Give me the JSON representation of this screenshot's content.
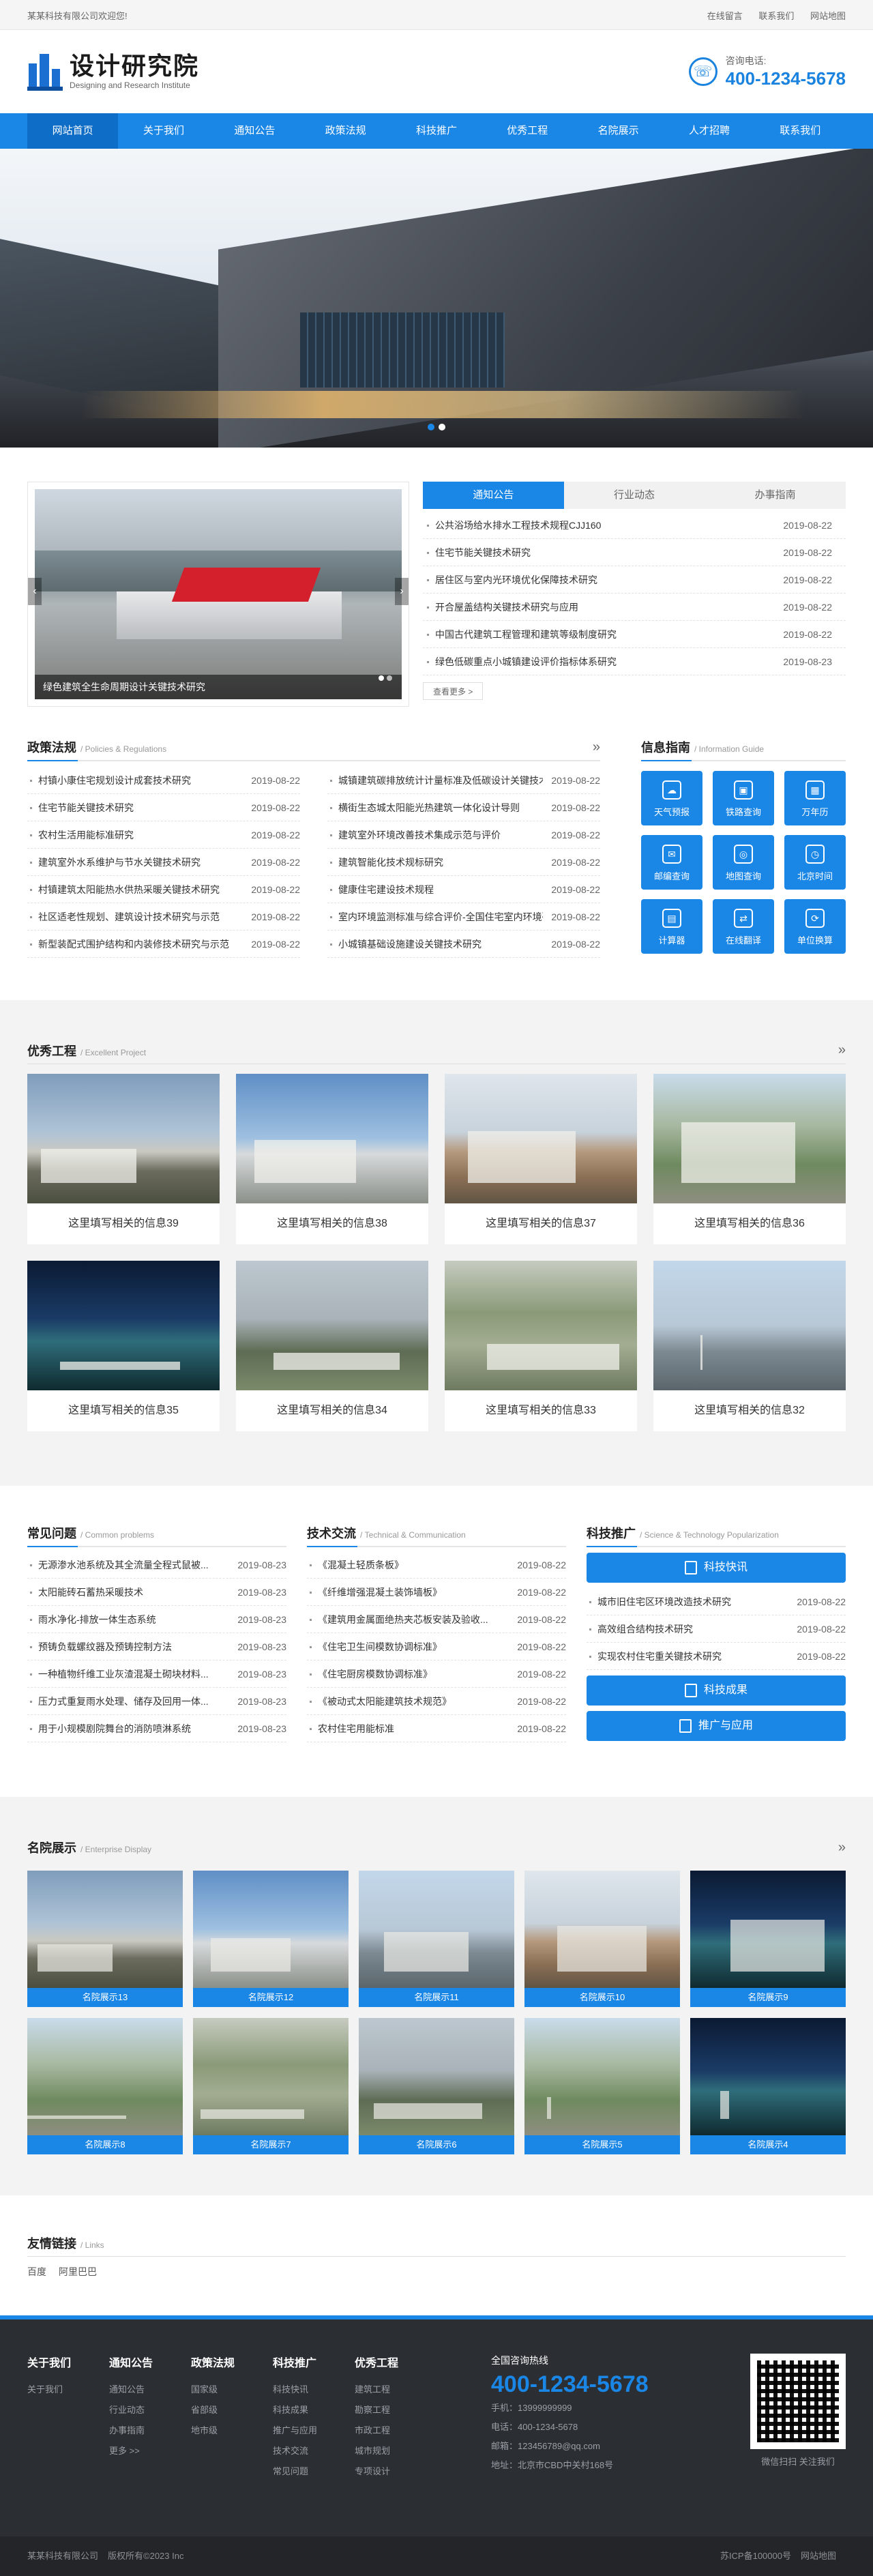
{
  "topbar": {
    "welcome": "某某科技有限公司欢迎您!",
    "links": [
      "在线留言",
      "联系我们",
      "网站地图"
    ]
  },
  "header": {
    "title": "设计研究院",
    "subtitle": "Designing and Research Institute",
    "phone_label": "咨询电话:",
    "phone": "400-1234-5678"
  },
  "nav": [
    "网站首页",
    "关于我们",
    "通知公告",
    "政策法规",
    "科技推广",
    "优秀工程",
    "名院展示",
    "人才招聘",
    "联系我们"
  ],
  "news": {
    "slide_caption": "绿色建筑全生命周期设计关键技术研究",
    "tabs": [
      "通知公告",
      "行业动态",
      "办事指南"
    ],
    "items": [
      {
        "t": "公共浴场给水排水工程技术规程CJJ160",
        "d": "2019-08-22"
      },
      {
        "t": "住宅节能关键技术研究",
        "d": "2019-08-22"
      },
      {
        "t": "居住区与室内光环境优化保障技术研究",
        "d": "2019-08-22"
      },
      {
        "t": "开合屋盖结构关键技术研究与应用",
        "d": "2019-08-22"
      },
      {
        "t": "中国古代建筑工程管理和建筑等级制度研究",
        "d": "2019-08-22"
      },
      {
        "t": "绿色低碳重点小城镇建设评价指标体系研究",
        "d": "2019-08-23"
      }
    ],
    "more": "查看更多 >"
  },
  "policy": {
    "title": "政策法规",
    "sub": "/ Policies & Regulations",
    "more": "»",
    "left": [
      {
        "t": "村镇小康住宅规划设计成套技术研究",
        "d": "2019-08-22"
      },
      {
        "t": "住宅节能关键技术研究",
        "d": "2019-08-22"
      },
      {
        "t": "农村生活用能标准研究",
        "d": "2019-08-22"
      },
      {
        "t": "建筑室外水系维护与节水关键技术研究",
        "d": "2019-08-22"
      },
      {
        "t": "村镇建筑太阳能热水供热采暖关键技术研究",
        "d": "2019-08-22"
      },
      {
        "t": "社区适老性规划、建筑设计技术研究与示范",
        "d": "2019-08-22"
      },
      {
        "t": "新型装配式围护结构和内装修技术研究与示范",
        "d": "2019-08-22"
      }
    ],
    "right": [
      {
        "t": "城镇建筑碳排放统计计量标准及低碳设计关键技术研究",
        "d": "2019-08-22"
      },
      {
        "t": "横街生态城太阳能光热建筑一体化设计导则",
        "d": "2019-08-22"
      },
      {
        "t": "建筑室外环境改善技术集成示范与评价",
        "d": "2019-08-22"
      },
      {
        "t": "建筑智能化技术规标研究",
        "d": "2019-08-22"
      },
      {
        "t": "健康住宅建设技术规程",
        "d": "2019-08-22"
      },
      {
        "t": "室内环境监测标准与综合评价-全国住宅室内环境研究",
        "d": "2019-08-22"
      },
      {
        "t": "小城镇基础设施建设关键技术研究",
        "d": "2019-08-22"
      }
    ]
  },
  "info": {
    "title": "信息指南",
    "sub": "/ Information Guide",
    "items": [
      {
        "l": "天气预报",
        "i": "☁"
      },
      {
        "l": "铁路查询",
        "i": "▣"
      },
      {
        "l": "万年历",
        "i": "▦"
      },
      {
        "l": "邮编查询",
        "i": "✉"
      },
      {
        "l": "地图查询",
        "i": "◎"
      },
      {
        "l": "北京时间",
        "i": "◷"
      },
      {
        "l": "计算器",
        "i": "▤"
      },
      {
        "l": "在线翻译",
        "i": "⇄"
      },
      {
        "l": "单位换算",
        "i": "⟳"
      }
    ]
  },
  "excellent": {
    "title": "优秀工程",
    "sub": "/ Excellent Project",
    "more": "»",
    "items": [
      "这里填写相关的信息39",
      "这里填写相关的信息38",
      "这里填写相关的信息37",
      "这里填写相关的信息36",
      "这里填写相关的信息35",
      "这里填写相关的信息34",
      "这里填写相关的信息33",
      "这里填写相关的信息32"
    ]
  },
  "faq": {
    "title": "常见问题",
    "sub": "/ Common problems",
    "items": [
      {
        "t": "无源渗水池系统及其全流量全程式鼠被...",
        "d": "2019-08-23"
      },
      {
        "t": "太阳能砖石蓄热采暖技术",
        "d": "2019-08-23"
      },
      {
        "t": "雨水净化-排放一体生态系统",
        "d": "2019-08-23"
      },
      {
        "t": "预铸负载螺纹器及预铸控制方法",
        "d": "2019-08-23"
      },
      {
        "t": "一种植物纤维工业灰渣混凝土砌块材料...",
        "d": "2019-08-23"
      },
      {
        "t": "压力式重复雨水处理、储存及回用一体...",
        "d": "2019-08-23"
      },
      {
        "t": "用于小规模剧院舞台的消防喷淋系统",
        "d": "2019-08-23"
      }
    ]
  },
  "tech": {
    "title": "技术交流",
    "sub": "/ Technical & Communication",
    "items": [
      {
        "t": "《混凝土轻质条板》",
        "d": "2019-08-22"
      },
      {
        "t": "《纤维增强混凝土装饰墙板》",
        "d": "2019-08-22"
      },
      {
        "t": "《建筑用金属面绝热夹芯板安装及验收...",
        "d": "2019-08-22"
      },
      {
        "t": "《住宅卫生间模数协调标准》",
        "d": "2019-08-22"
      },
      {
        "t": "《住宅厨房模数协调标准》",
        "d": "2019-08-22"
      },
      {
        "t": "《被动式太阳能建筑技术规范》",
        "d": "2019-08-22"
      },
      {
        "t": "农村住宅用能标准",
        "d": "2019-08-22"
      }
    ]
  },
  "promo": {
    "title": "科技推广",
    "sub": "/ Science & Technology Popularization",
    "btn1": "科技快讯",
    "btn2": "科技成果",
    "btn3": "推广与应用",
    "items": [
      {
        "t": "城市旧住宅区环境改造技术研究",
        "d": "2019-08-22"
      },
      {
        "t": "高效组合结构技术研究",
        "d": "2019-08-22"
      },
      {
        "t": "实现农村住宅重关键技术研究",
        "d": "2019-08-22"
      }
    ]
  },
  "famous": {
    "title": "名院展示",
    "sub": "/ Enterprise Display",
    "more": "»",
    "items": [
      "名院展示13",
      "名院展示12",
      "名院展示11",
      "名院展示10",
      "名院展示9",
      "名院展示8",
      "名院展示7",
      "名院展示6",
      "名院展示5",
      "名院展示4"
    ]
  },
  "links": {
    "title": "友情链接",
    "sub": "/ Links",
    "items": [
      "百度",
      "阿里巴巴"
    ]
  },
  "footer": {
    "cols": [
      {
        "h": "关于我们",
        "items": [
          "关于我们"
        ]
      },
      {
        "h": "通知公告",
        "items": [
          "通知公告",
          "行业动态",
          "办事指南",
          "更多 >>"
        ]
      },
      {
        "h": "政策法规",
        "items": [
          "国家级",
          "省部级",
          "地市级"
        ]
      },
      {
        "h": "科技推广",
        "items": [
          "科技快讯",
          "科技成果",
          "推广与应用",
          "技术交流",
          "常见问题"
        ]
      },
      {
        "h": "优秀工程",
        "items": [
          "建筑工程",
          "勘察工程",
          "市政工程",
          "城市规划",
          "专项设计"
        ]
      }
    ],
    "hotline_label": "全国咨询热线",
    "hotline": "400-1234-5678",
    "mobile": "手机：13999999999",
    "tel": "电话：400-1234-5678",
    "email": "邮箱：123456789@qq.com",
    "addr": "地址：北京市CBD中关村168号",
    "qr_caption": "微信扫扫 关注我们",
    "copyright": [
      "某某科技有限公司",
      "版权所有©2023 Inc"
    ],
    "icp": [
      "苏ICP备100000号",
      "网站地图"
    ]
  }
}
